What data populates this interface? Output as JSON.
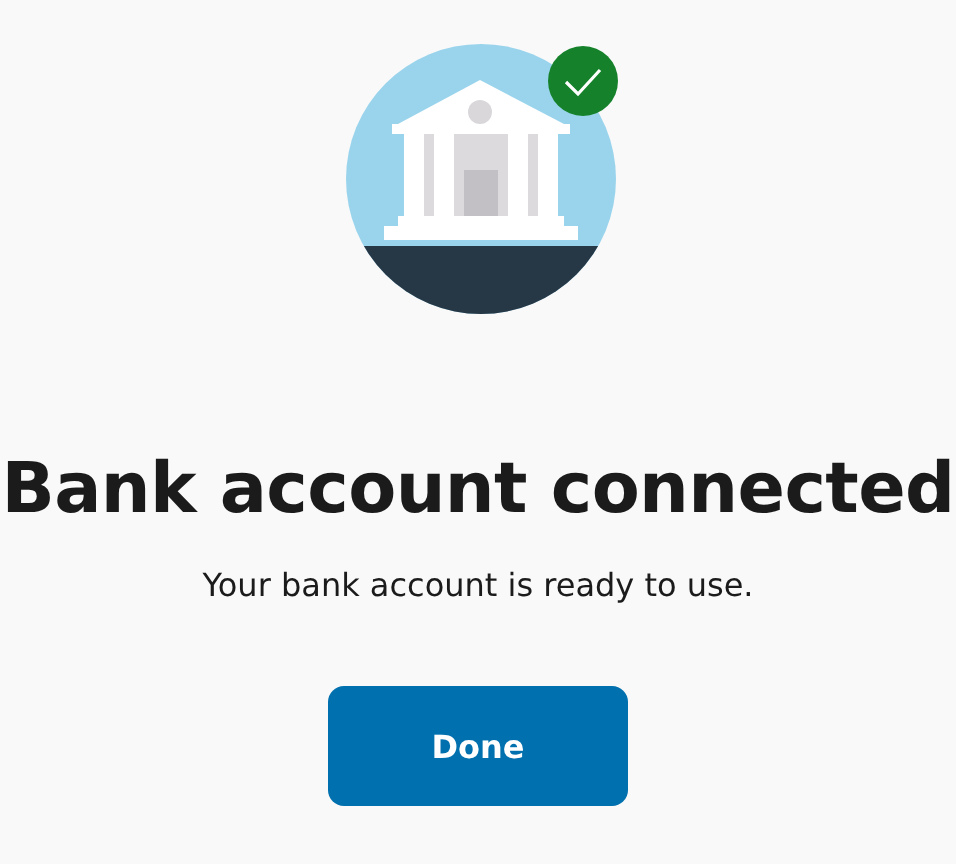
{
  "status": {
    "connected": true
  },
  "title": "Bank account connected",
  "message": "Your bank account is ready to use.",
  "buttons": [
    {
      "label": "Done"
    }
  ]
}
